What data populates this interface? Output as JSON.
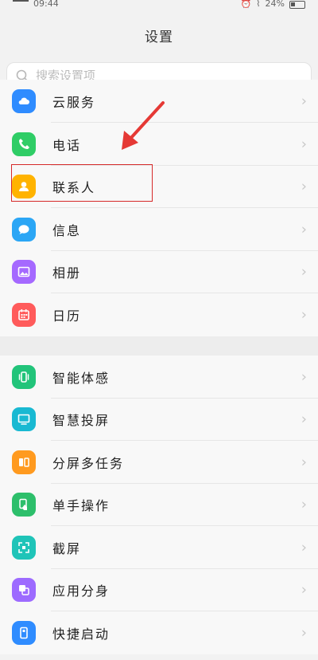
{
  "status_bar": {
    "time": "09:44",
    "battery": "24%"
  },
  "header": {
    "title": "设置"
  },
  "search": {
    "placeholder": "搜索设置项"
  },
  "colors": {
    "highlight": "#d62a2a",
    "arrow": "#e53935"
  },
  "items_top": [
    {
      "label": "云服务",
      "icon": "cloud-icon",
      "color": "#2f8cff"
    },
    {
      "label": "电话",
      "icon": "phone-icon",
      "color": "#2fcd66"
    },
    {
      "label": "联系人",
      "icon": "contacts-icon",
      "color": "#ffb300"
    },
    {
      "label": "信息",
      "icon": "message-icon",
      "color": "#2ba6f5"
    },
    {
      "label": "相册",
      "icon": "gallery-icon",
      "color": "#a569ff"
    },
    {
      "label": "日历",
      "icon": "calendar-icon",
      "color": "#ff5b5b"
    }
  ],
  "items_bottom": [
    {
      "label": "智能体感",
      "icon": "motion-icon",
      "color": "#22c47a"
    },
    {
      "label": "智慧投屏",
      "icon": "cast-icon",
      "color": "#19b9d2"
    },
    {
      "label": "分屏多任务",
      "icon": "split-screen-icon",
      "color": "#ff9a1f"
    },
    {
      "label": "单手操作",
      "icon": "one-hand-icon",
      "color": "#2dbf6b"
    },
    {
      "label": "截屏",
      "icon": "screenshot-icon",
      "color": "#1fc4b8"
    },
    {
      "label": "应用分身",
      "icon": "app-clone-icon",
      "color": "#9d6bff"
    },
    {
      "label": "快捷启动",
      "icon": "quick-launch-icon",
      "color": "#2f8cff"
    }
  ]
}
